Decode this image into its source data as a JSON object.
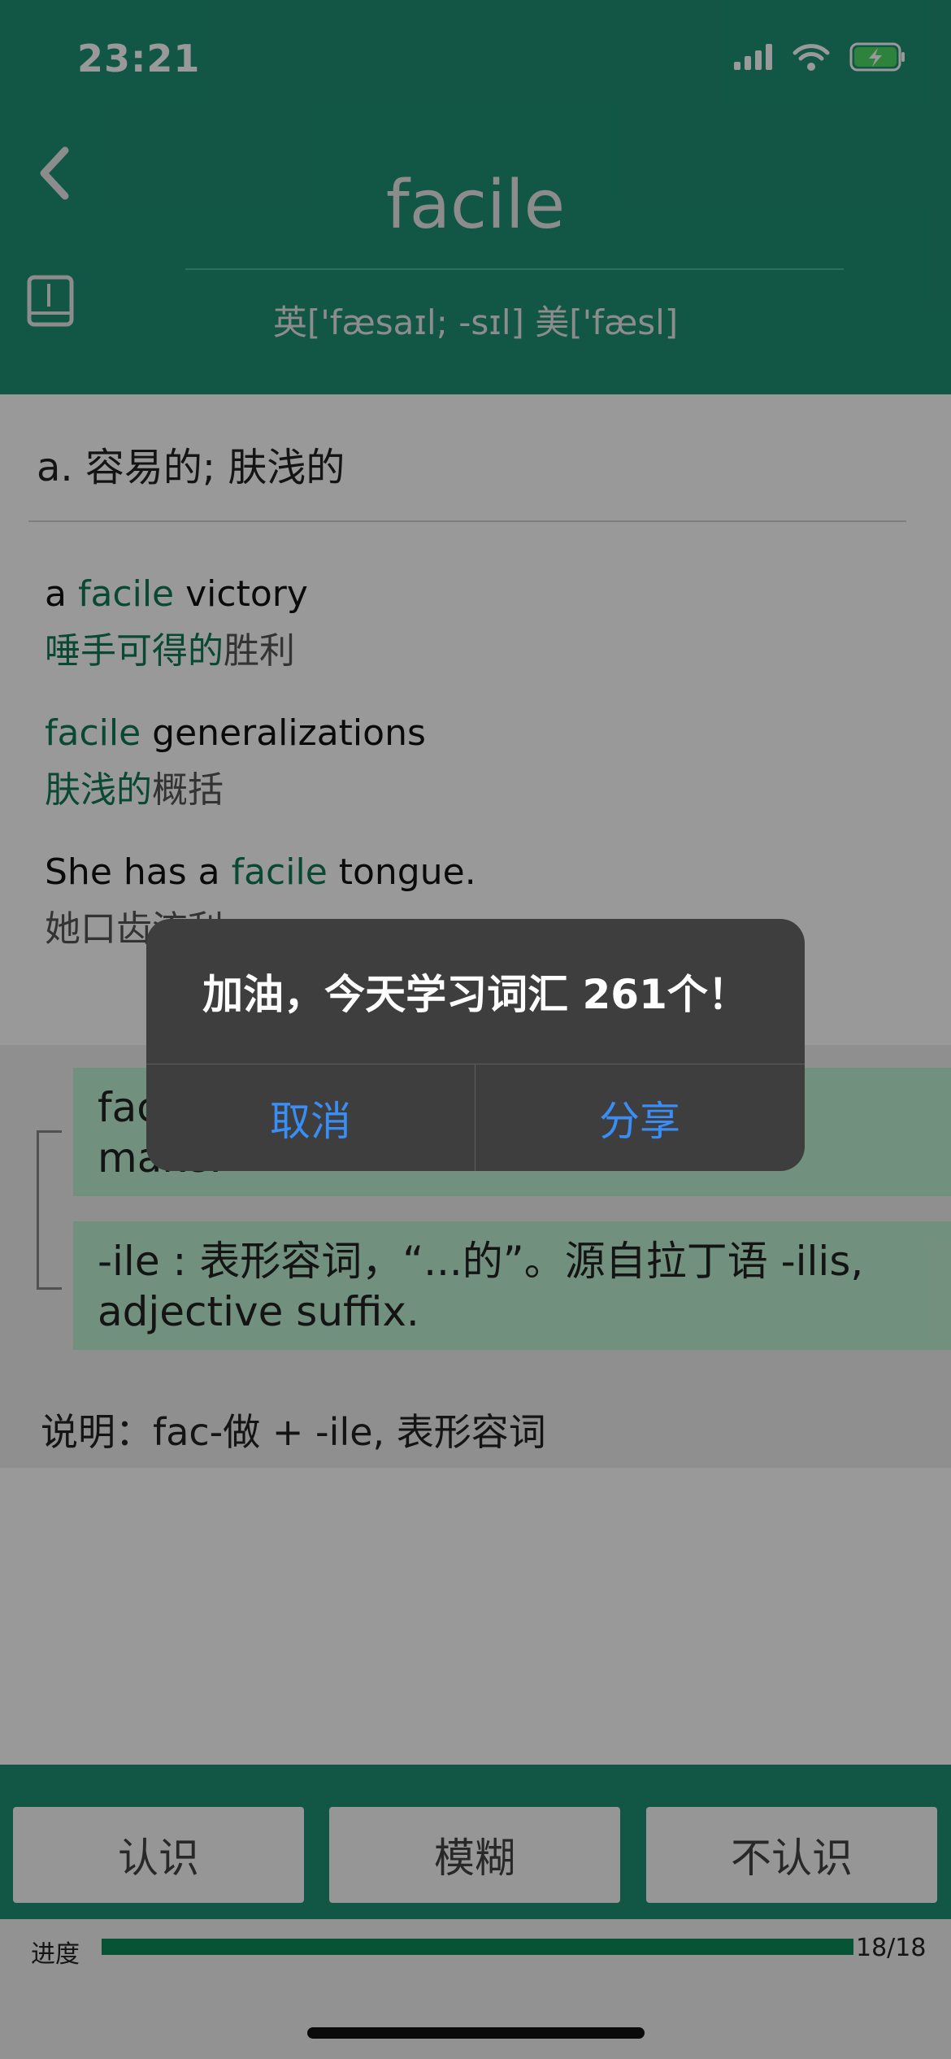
{
  "status_bar": {
    "time": "23:21"
  },
  "header": {
    "word": "facile",
    "phonetic": "英['fæsaɪl; -sɪl]  美['fæsl]"
  },
  "definition": "a. 容易的; 肤浅的",
  "examples": [
    {
      "en_pre": "a ",
      "en_hl": "facile",
      "en_post": " victory",
      "cn_hl": "唾手可得的",
      "cn_rest": "胜利"
    },
    {
      "en_pre": "",
      "en_hl": "facile",
      "en_post": " generalizations",
      "cn_hl": "肤浅的",
      "cn_rest": "概括"
    },
    {
      "en_pre": "She has a ",
      "en_hl": "facile",
      "en_post": " tongue.",
      "cn_hl": "",
      "cn_rest": "她口齿流利"
    }
  ],
  "etymology": [
    {
      "text": "fac-：做，源自拉丁语 facere “to do, make.”"
    },
    {
      "text": "-ile : 表形容词，“...的”。源自拉丁语 -ilis, adjective suffix."
    }
  ],
  "explanation": "说明：fac-做 + -ile, 表形容词",
  "actions": {
    "know": "认识",
    "fuzzy": "模糊",
    "unknown": "不认识"
  },
  "progress": {
    "label": "进度",
    "count": "18/18",
    "fraction": 1.0
  },
  "dialog": {
    "message": "加油，今天学习词汇 261个！",
    "cancel": "取消",
    "share": "分享"
  },
  "colors": {
    "header_green": "#1f8f73",
    "highlight_green": "#0f7a56",
    "etym_green": "#bff0d2",
    "progress_green": "#0a8a59",
    "dialog_bg": "#3e3e3e",
    "dialog_button": "#3a8df5",
    "battery_green": "#4cd964"
  }
}
